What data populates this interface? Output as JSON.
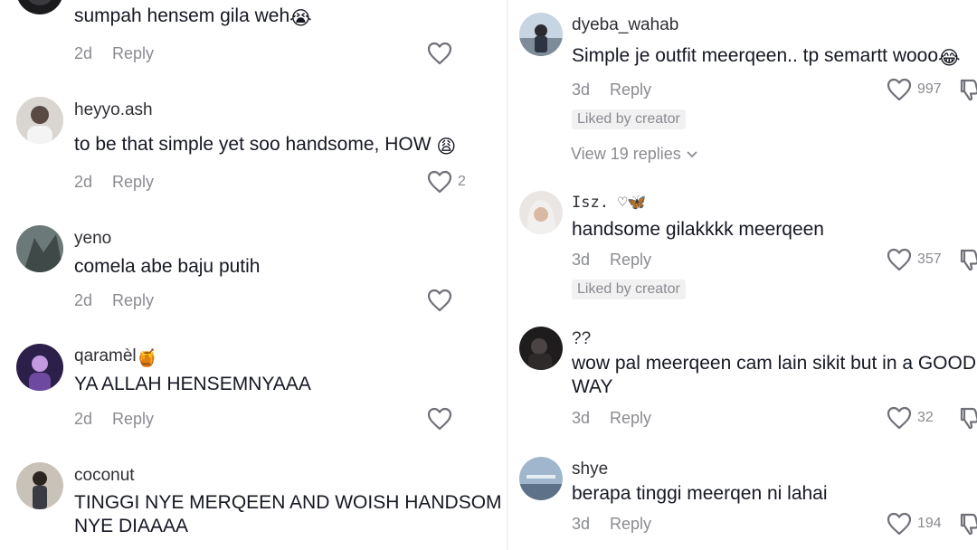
{
  "left": [
    {
      "username": "",
      "text": "sumpah hensem gila weh",
      "emoji": "😭",
      "time": "2d",
      "reply": "Reply",
      "likes": ""
    },
    {
      "username": "heyyo.ash",
      "text": "to be that simple yet soo handsome, HOW",
      "emoji": "😩",
      "time": "2d",
      "reply": "Reply",
      "likes": "2"
    },
    {
      "username": "yeno",
      "text": "comela abe baju putih",
      "emoji": "",
      "time": "2d",
      "reply": "Reply",
      "likes": ""
    },
    {
      "username": "qaramèl",
      "username_emoji": "🍯",
      "text": "YA ALLAH HENSEMNYAAA",
      "emoji": "",
      "time": "2d",
      "reply": "Reply",
      "likes": ""
    },
    {
      "username": "coconut",
      "text_line1": "TINGGI NYE MERQEEN AND WOISH HANDSOM",
      "text_line2": "NYE DIAAAA"
    }
  ],
  "right": [
    {
      "username": "dyeba_wahab",
      "text": "Simple je outfit meerqeen.. tp semartt wooo",
      "emoji": "😂",
      "time": "3d",
      "reply": "Reply",
      "likes": "997",
      "badge": "Liked by creator",
      "view_replies": "View 19 replies"
    },
    {
      "username": "Isz. ♡🦋",
      "text": "handsome gilakkkk meerqeen",
      "time": "3d",
      "reply": "Reply",
      "likes": "357",
      "badge": "Liked by creator"
    },
    {
      "username": "??",
      "text_line1": "wow pal meerqeen cam lain sikit but in a GOOD",
      "text_line2": "WAY",
      "time": "3d",
      "reply": "Reply",
      "likes": "32"
    },
    {
      "username": "shye",
      "text": "berapa tinggi meerqen ni lahai",
      "time": "3d",
      "reply": "Reply",
      "likes": "194"
    }
  ],
  "colors": {
    "text": "#161823",
    "muted": "#8a8b91",
    "badge_bg": "#f1f1f2"
  }
}
